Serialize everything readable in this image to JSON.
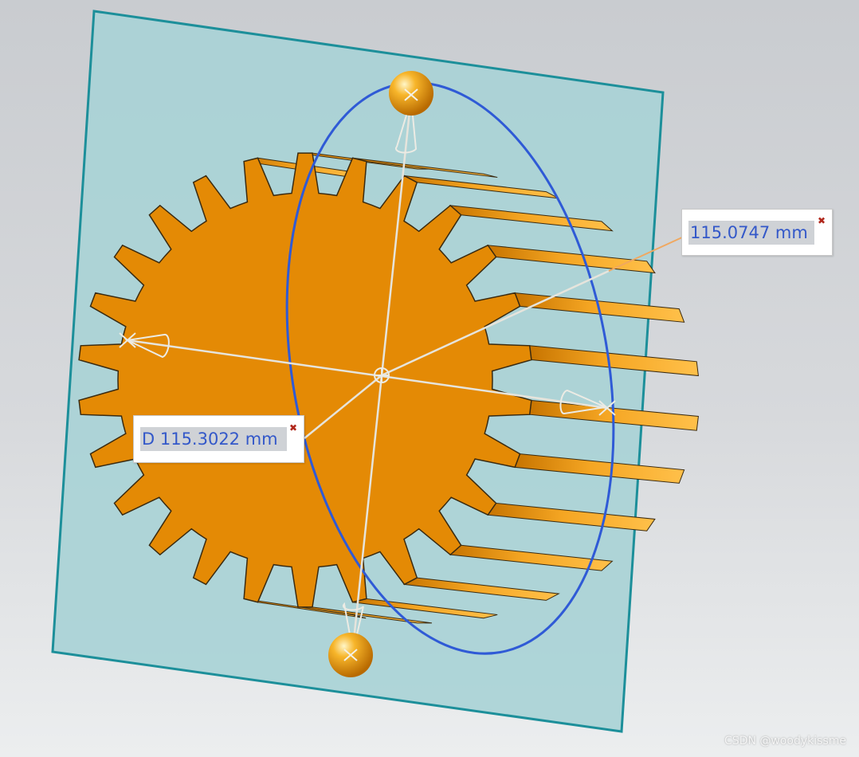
{
  "measurements": {
    "arc_length": {
      "value": "115.0747 mm",
      "close_icon": "close-icon"
    },
    "diameter": {
      "value": "D 115.3022 mm",
      "close_icon": "close-icon"
    }
  },
  "watermark": "CSDN @woodykissme",
  "colors": {
    "background_top": "#c9ccd0",
    "background_bottom": "#eceeef",
    "datum_plane": "#a9d3d6",
    "datum_plane_edge": "#1c8f9a",
    "gear_face": "#e48a05",
    "gear_teeth": "#f2a21a",
    "measure_circle": "#2f5ad6",
    "measure_lines": "#e6e4dc",
    "leader_line": "#f0a860",
    "dimension_text": "#3358c9",
    "handle_sphere": "#f0a010"
  }
}
